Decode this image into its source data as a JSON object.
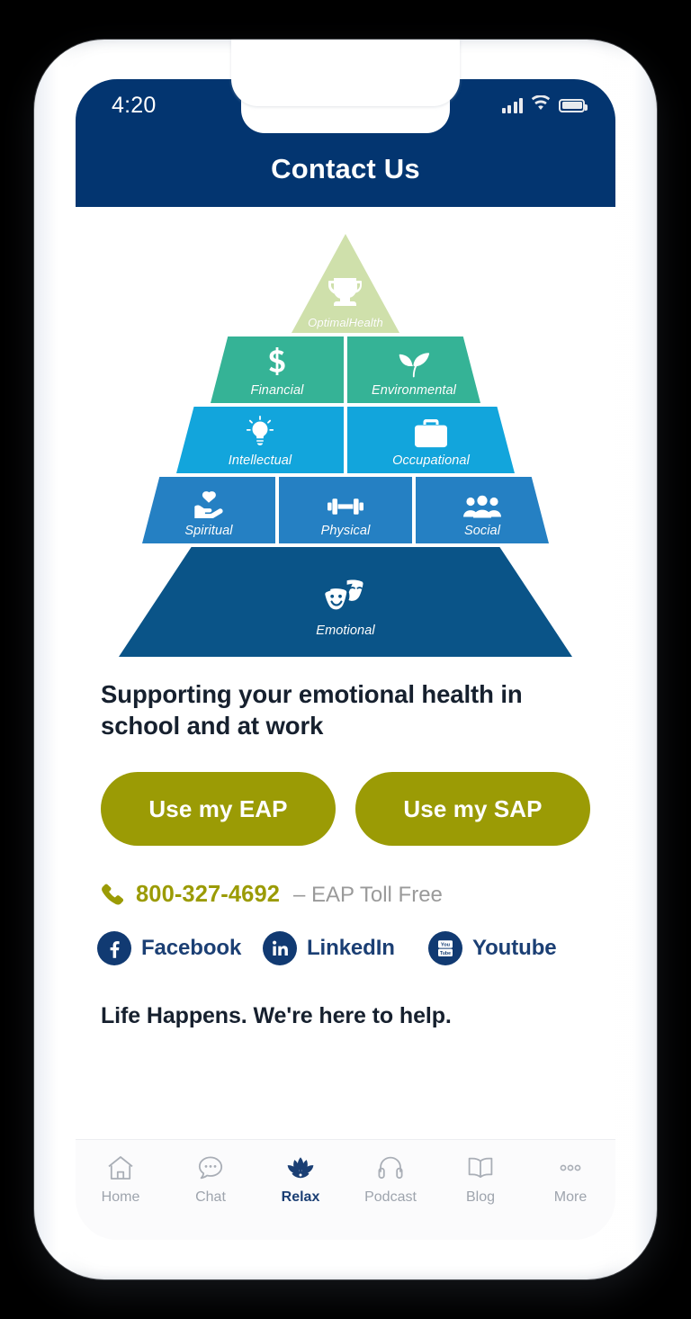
{
  "device": {
    "status_bar": {
      "time": "4:20",
      "signal_icon": "cellular-signal-icon",
      "wifi_icon": "wifi-icon",
      "battery_icon": "battery-icon"
    }
  },
  "header": {
    "title": "Contact Us",
    "background_color": "#033570"
  },
  "pyramid": {
    "name": "optimal-health-wellness-pyramid",
    "tiers": [
      {
        "level": 1,
        "color": "#cfe0ab",
        "cells": [
          {
            "label": "OptimalHealth",
            "icon": "trophy-icon"
          }
        ]
      },
      {
        "level": 2,
        "color": "#35b396",
        "cells": [
          {
            "label": "Financial",
            "icon": "dollar-sign-icon"
          },
          {
            "label": "Environmental",
            "icon": "leaf-icon"
          }
        ]
      },
      {
        "level": 3,
        "color": "#12a5dc",
        "cells": [
          {
            "label": "Intellectual",
            "icon": "lightbulb-icon"
          },
          {
            "label": "Occupational",
            "icon": "briefcase-icon"
          }
        ]
      },
      {
        "level": 4,
        "color": "#2580c3",
        "cells": [
          {
            "label": "Spiritual",
            "icon": "heart-in-hand-icon"
          },
          {
            "label": "Physical",
            "icon": "dumbbell-icon"
          },
          {
            "label": "Social",
            "icon": "people-group-icon"
          }
        ]
      },
      {
        "level": 5,
        "color": "#0a5488",
        "cells": [
          {
            "label": "Emotional",
            "icon": "theater-masks-icon"
          }
        ]
      }
    ]
  },
  "main": {
    "headline": "Supporting your emotional health in school and at work",
    "footer_tagline": "Life Happens. We're here to help.",
    "buttons": [
      {
        "label": "Use my EAP",
        "color": "#9b9b05"
      },
      {
        "label": "Use my SAP",
        "color": "#9b9b05"
      }
    ],
    "phone": {
      "icon": "phone-handset-icon",
      "number": "800-327-4692",
      "separator_and_label": "– EAP Toll Free",
      "number_color": "#9b9b05",
      "label_color": "#9a9a9a"
    },
    "social": [
      {
        "label": "Facebook",
        "icon": "facebook-icon"
      },
      {
        "label": "LinkedIn",
        "icon": "linkedin-icon"
      },
      {
        "label": "Youtube",
        "icon": "youtube-icon"
      }
    ]
  },
  "bottom_nav": {
    "active_color": "#1b3f74",
    "inactive_color": "#9ea4ad",
    "items": [
      {
        "label": "Home",
        "icon": "house-icon",
        "active": false
      },
      {
        "label": "Chat",
        "icon": "chat-bubble-icon",
        "active": false
      },
      {
        "label": "Relax",
        "icon": "lotus-flower-icon",
        "active": true
      },
      {
        "label": "Podcast",
        "icon": "headphones-icon",
        "active": false
      },
      {
        "label": "Blog",
        "icon": "open-book-icon",
        "active": false
      },
      {
        "label": "More",
        "icon": "ellipsis-icon",
        "active": false
      }
    ]
  }
}
